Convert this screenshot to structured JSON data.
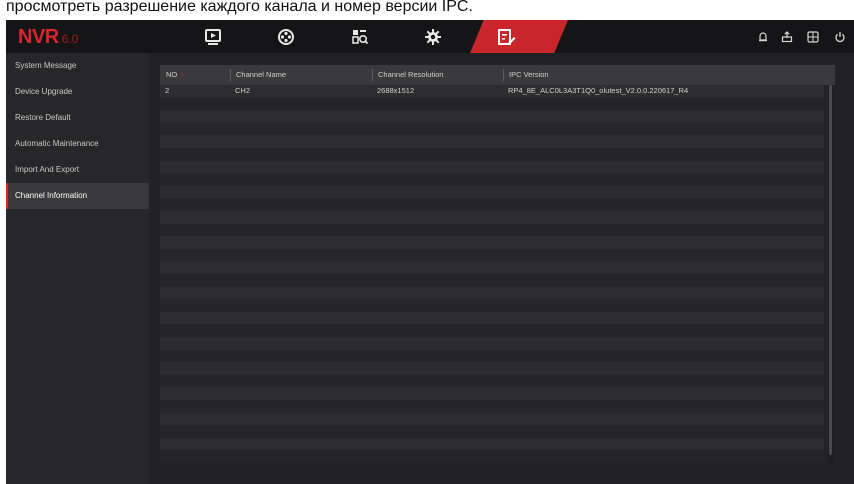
{
  "caption": "просмотреть разрешение каждого канала и номер версии IPC.",
  "app": {
    "brand": "NVR",
    "version": "6.0"
  },
  "nav": {
    "tabs": [
      {
        "icon": "playback-icon"
      },
      {
        "icon": "channel-icon"
      },
      {
        "icon": "search-icon"
      },
      {
        "icon": "settings-gear-icon"
      },
      {
        "icon": "maintenance-icon",
        "active": true
      }
    ],
    "right_buttons": [
      "alarm-icon",
      "backup-icon",
      "layout-icon",
      "power-icon"
    ]
  },
  "sidebar": {
    "items": [
      {
        "label": "System Message"
      },
      {
        "label": "Device Upgrade"
      },
      {
        "label": "Restore Default"
      },
      {
        "label": "Automatic Maintenance"
      },
      {
        "label": "Import And Export"
      },
      {
        "label": "Channel Information",
        "active": true
      }
    ]
  },
  "table": {
    "columns": [
      {
        "label": "NO",
        "sorted": true,
        "sort_glyph": "↑"
      },
      {
        "label": "Channel Name"
      },
      {
        "label": "Channel Resolution"
      },
      {
        "label": "IPC Version"
      }
    ],
    "rows": [
      [
        "2",
        "CH2",
        "2688x1512",
        "RP4_8E_ALC0L3A3T1Q0_olutest_V2.0.0.220617_R4"
      ]
    ]
  },
  "colors": {
    "accent": "#d7262c",
    "active_tab": "#c9262b",
    "background": "#2a2a2c",
    "topbar": "#151517"
  }
}
